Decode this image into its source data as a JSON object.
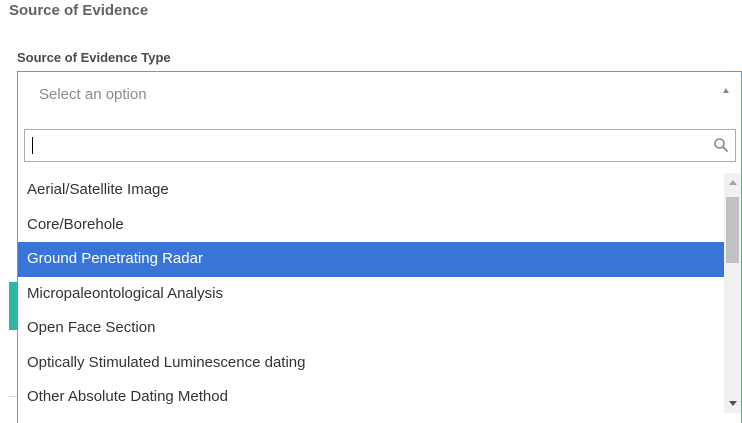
{
  "section": {
    "title": "Source of Evidence"
  },
  "field": {
    "label": "Source of Evidence Type",
    "placeholder": "Select an option"
  },
  "dropdown": {
    "search_value": "",
    "options": [
      "Aerial/Satellite Image",
      "Core/Borehole",
      "Ground Penetrating Radar",
      "Micropaleontological Analysis",
      "Open Face Section",
      "Optically Stimulated Luminescence dating",
      "Other Absolute Dating Method"
    ],
    "highlighted": "Ground Penetrating Radar"
  },
  "icons": {
    "search": "search-icon",
    "select_arrow": "chevron-up-icon",
    "scroll_up": "scroll-up-arrow-icon",
    "scroll_down": "scroll-down-arrow-icon"
  },
  "colors": {
    "focus_border": "#5897fb",
    "highlight": "#3875d7",
    "accent": "#2bb7a4"
  }
}
